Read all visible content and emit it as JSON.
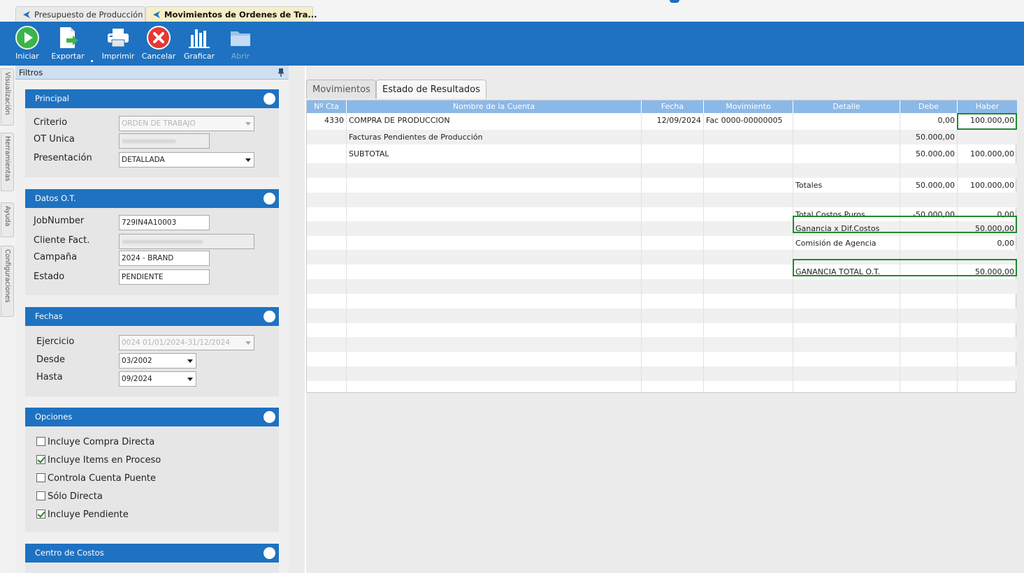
{
  "tabs": [
    {
      "label": "Presupuesto de Producción",
      "active": false
    },
    {
      "label": "Movimientos de Ordenes de Tra...",
      "active": true
    }
  ],
  "toolbar": {
    "iniciar": "Iniciar",
    "exportar": "Exportar",
    "imprimir": "Imprimir",
    "cancelar": "Cancelar",
    "graficar": "Graficar",
    "abrir": "Abrir"
  },
  "side_tabs": [
    "Visualización",
    "Herramientas",
    "Ayuda",
    "Configuraciones"
  ],
  "filters": {
    "title": "Filtros",
    "principal": {
      "title": "Principal",
      "criterio_label": "Criterio",
      "criterio_value": "ORDEN DE TRABAJO",
      "ot_label": "OT Unica",
      "presentacion_label": "Presentación",
      "presentacion_value": "DETALLADA"
    },
    "datos": {
      "title": "Datos O.T.",
      "jobnumber_label": "JobNumber",
      "jobnumber_value": "729IN4A10003",
      "cliente_label": "Cliente Fact.",
      "campana_label": "Campaña",
      "campana_value": "2024 - BRAND",
      "estado_label": "Estado",
      "estado_value": "PENDIENTE"
    },
    "fechas": {
      "title": "Fechas",
      "ejercicio_label": "Ejercicio",
      "ejercicio_value": "0024 01/01/2024-31/12/2024",
      "desde_label": "Desde",
      "desde_value": "03/2002",
      "hasta_label": "Hasta",
      "hasta_value": "09/2024"
    },
    "opciones": {
      "title": "Opciones",
      "items": [
        {
          "label": "Incluye Compra Directa",
          "checked": false
        },
        {
          "label": "Incluye Items en Proceso",
          "checked": true
        },
        {
          "label": "Controla Cuenta Puente",
          "checked": false
        },
        {
          "label": "Sólo Directa",
          "checked": false
        },
        {
          "label": "Incluye Pendiente",
          "checked": true
        }
      ]
    },
    "centro": {
      "title": "Centro de Costos"
    }
  },
  "content_tabs": [
    "Movimientos",
    "Estado de Resultados"
  ],
  "grid": {
    "columns": [
      "Nº Cta",
      "Nombre de la Cuenta",
      "Fecha",
      "Movimiento",
      "Detalle",
      "Debe",
      "Haber"
    ],
    "rows": [
      {
        "cta": "4330",
        "nombre": "COMPRA DE PRODUCCION",
        "fecha": "12/09/2024",
        "mov": "Fac 0000-00000005",
        "detalle": "",
        "debe": "0,00",
        "haber": "100.000,00"
      },
      {
        "cta": "",
        "nombre": "Facturas Pendientes de Producción",
        "fecha": "",
        "mov": "",
        "detalle": "",
        "debe": "50.000,00",
        "haber": ""
      },
      {
        "cta": "",
        "nombre": "SUBTOTAL",
        "fecha": "",
        "mov": "",
        "detalle": "",
        "debe": "50.000,00",
        "haber": "100.000,00"
      },
      {
        "cta": "",
        "nombre": "",
        "fecha": "",
        "mov": "",
        "detalle": "",
        "debe": "",
        "haber": ""
      },
      {
        "cta": "",
        "nombre": "",
        "fecha": "",
        "mov": "",
        "detalle": "Totales",
        "debe": "50.000,00",
        "haber": "100.000,00"
      },
      {
        "cta": "",
        "nombre": "",
        "fecha": "",
        "mov": "",
        "detalle": "",
        "debe": "",
        "haber": ""
      },
      {
        "cta": "",
        "nombre": "",
        "fecha": "",
        "mov": "",
        "detalle": "Total Costos Puros",
        "debe": "-50.000,00",
        "haber": "0,00"
      },
      {
        "cta": "",
        "nombre": "",
        "fecha": "",
        "mov": "",
        "detalle": "Ganancia x Dif.Costos",
        "debe": "",
        "haber": "50.000,00"
      },
      {
        "cta": "",
        "nombre": "",
        "fecha": "",
        "mov": "",
        "detalle": "Comisión de Agencia",
        "debe": "",
        "haber": "0,00"
      },
      {
        "cta": "",
        "nombre": "",
        "fecha": "",
        "mov": "",
        "detalle": "",
        "debe": "",
        "haber": ""
      },
      {
        "cta": "",
        "nombre": "",
        "fecha": "",
        "mov": "",
        "detalle": "GANANCIA TOTAL O.T.",
        "debe": "",
        "haber": "50.000,00"
      }
    ]
  }
}
